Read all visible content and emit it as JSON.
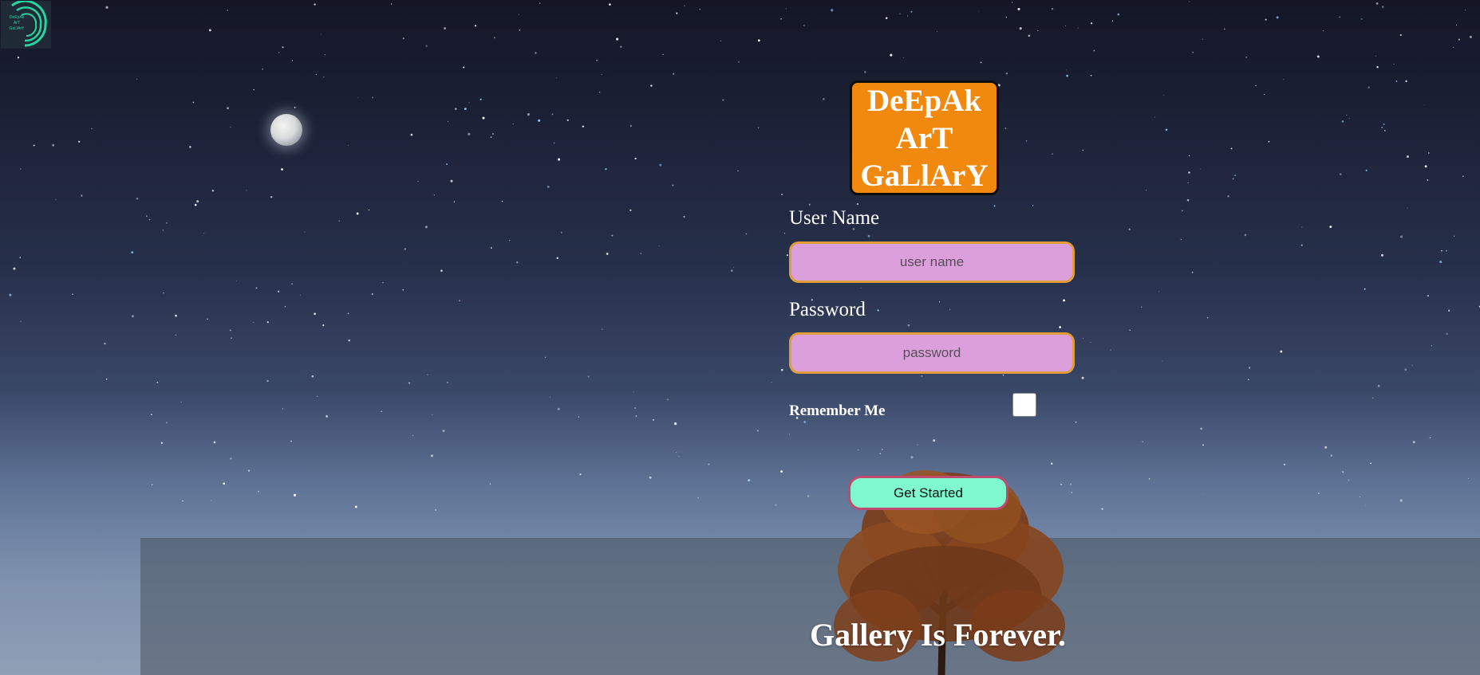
{
  "brand": {
    "corner_logo_text": [
      "DeEpAk",
      "ArT",
      "GaLlArY"
    ],
    "title_lines": [
      "DeEpAk",
      "ArT",
      "GaLlArY"
    ],
    "title_bg_color": "#f2890f"
  },
  "login_form": {
    "username_label": "User Name",
    "username_placeholder": "user name",
    "password_label": "Password",
    "password_placeholder": "password",
    "remember_label": "Remember Me",
    "remember_checked": false,
    "submit_label": "Get Started",
    "input_bg_color": "#dba0dc",
    "button_bg_color": "#7ff7cf"
  },
  "hero": {
    "tagline": "Gallery Is Forever."
  },
  "icons": {
    "corner_logo": "spiral-logo-icon",
    "moon": "moon-icon"
  }
}
